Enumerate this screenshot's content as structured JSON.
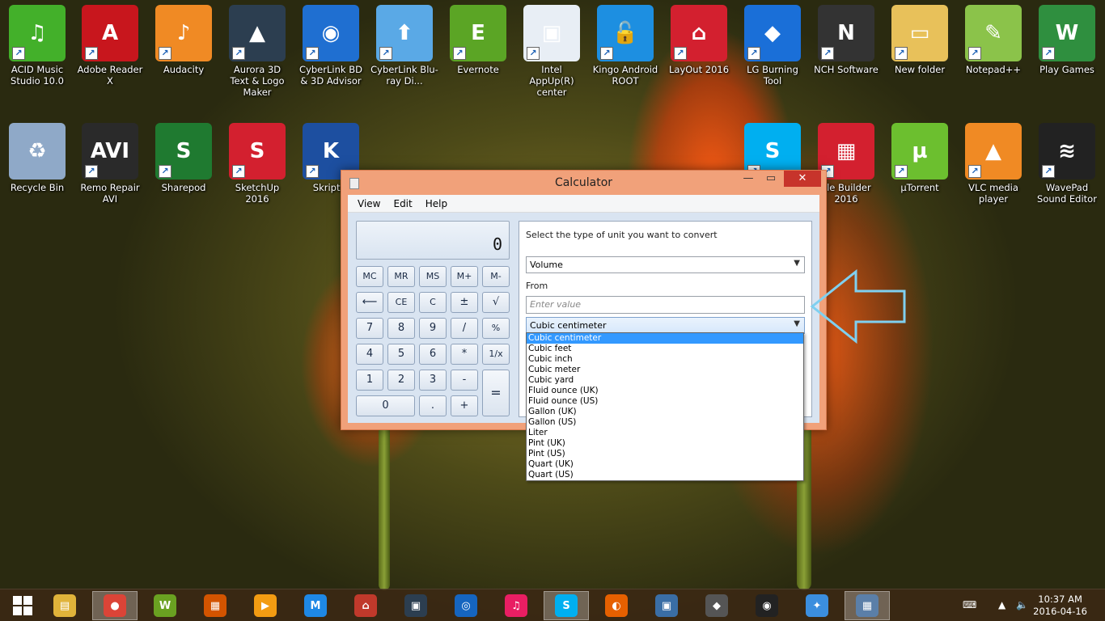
{
  "desktop_icons": [
    {
      "label": "ACID Music Studio 10.0",
      "glyph": "♫",
      "color": "#43b02a"
    },
    {
      "label": "Adobe Reader X",
      "glyph": "A",
      "color": "#c8161d"
    },
    {
      "label": "Audacity",
      "glyph": "♪",
      "color": "#f08a24"
    },
    {
      "label": "Aurora 3D Text & Logo Maker",
      "glyph": "▲",
      "color": "#2c3e50"
    },
    {
      "label": "CyberLink BD & 3D Advisor",
      "glyph": "◉",
      "color": "#1f6fd1"
    },
    {
      "label": "CyberLink Blu-ray Di...",
      "glyph": "⬆",
      "color": "#5aa9e6"
    },
    {
      "label": "Evernote",
      "glyph": "E",
      "color": "#5ba525"
    },
    {
      "label": "Intel AppUp(R) center",
      "glyph": "▣",
      "color": "#e8eef5"
    },
    {
      "label": "Kingo Android ROOT",
      "glyph": "🔓",
      "color": "#1d8fe1"
    },
    {
      "label": "LayOut 2016",
      "glyph": "⌂",
      "color": "#d3202f"
    },
    {
      "label": "LG Burning Tool",
      "glyph": "◆",
      "color": "#1a6fd8"
    },
    {
      "label": "NCH Software",
      "glyph": "N",
      "color": "#333"
    },
    {
      "label": "New folder",
      "glyph": "▭",
      "color": "#e8c15a"
    },
    {
      "label": "Notepad++",
      "glyph": "✎",
      "color": "#8bc34a"
    },
    {
      "label": "Play Games",
      "glyph": "W",
      "color": "#2f8f3f"
    },
    {
      "label": "Recycle Bin",
      "glyph": "♻",
      "color": "#8fa9c8"
    },
    {
      "label": "Remo Repair AVI",
      "glyph": "AVI",
      "color": "#2a2a2a"
    },
    {
      "label": "Sharepod",
      "glyph": "S",
      "color": "#1f7a30"
    },
    {
      "label": "SketchUp 2016",
      "glyph": "S",
      "color": "#d3202f"
    },
    {
      "label": "Skript.e",
      "glyph": "K",
      "color": "#1d4fa0"
    },
    {
      "label": "",
      "glyph": "S",
      "color": "#00aff0"
    },
    {
      "label": "yle Builder 2016",
      "glyph": "▦",
      "color": "#d3202f"
    },
    {
      "label": "µTorrent",
      "glyph": "µ",
      "color": "#6cbf2f"
    },
    {
      "label": "VLC media player",
      "glyph": "▲",
      "color": "#f08a24"
    },
    {
      "label": "WavePad Sound Editor",
      "glyph": "≋",
      "color": "#222"
    }
  ],
  "calculator": {
    "title": "Calculator",
    "menu": [
      "View",
      "Edit",
      "Help"
    ],
    "display": "0",
    "keys": {
      "mc": "MC",
      "mr": "MR",
      "ms": "MS",
      "mplus": "M+",
      "mminus": "M-",
      "back": "⟵",
      "ce": "CE",
      "c": "C",
      "pm": "±",
      "sqrt": "√",
      "k7": "7",
      "k8": "8",
      "k9": "9",
      "div": "/",
      "pct": "%",
      "k4": "4",
      "k5": "5",
      "k6": "6",
      "mul": "*",
      "inv": "1/x",
      "k1": "1",
      "k2": "2",
      "k3": "3",
      "minus": "-",
      "eq": "=",
      "k0": "0",
      "dot": ".",
      "plus": "+"
    },
    "converter": {
      "prompt": "Select the type of unit you want to convert",
      "unit_type": "Volume",
      "from_label": "From",
      "value_placeholder": "Enter value",
      "from_unit": "Cubic centimeter",
      "options": [
        "Cubic centimeter",
        "Cubic feet",
        "Cubic inch",
        "Cubic meter",
        "Cubic yard",
        "Fluid ounce (UK)",
        "Fluid ounce (US)",
        "Gallon (UK)",
        "Gallon (US)",
        "Liter",
        "Pint (UK)",
        "Pint (US)",
        "Quart (UK)",
        "Quart (US)"
      ]
    }
  },
  "taskbar": {
    "items": [
      "file-explorer",
      "chrome",
      "wondershare",
      "windows-store",
      "media-player",
      "malwarebytes",
      "home-app",
      "video-app",
      "wifi-app",
      "itunes",
      "skype",
      "firefox",
      "remote-desktop",
      "ahead-app",
      "media-center",
      "safari",
      "calculator"
    ],
    "clock_time": "10:37 AM",
    "clock_date": "2016-04-16"
  },
  "colors": {
    "accent": "#f1a17a",
    "close": "#c7342b",
    "highlight": "#3399ff",
    "arrow": "#7fd0f0"
  }
}
